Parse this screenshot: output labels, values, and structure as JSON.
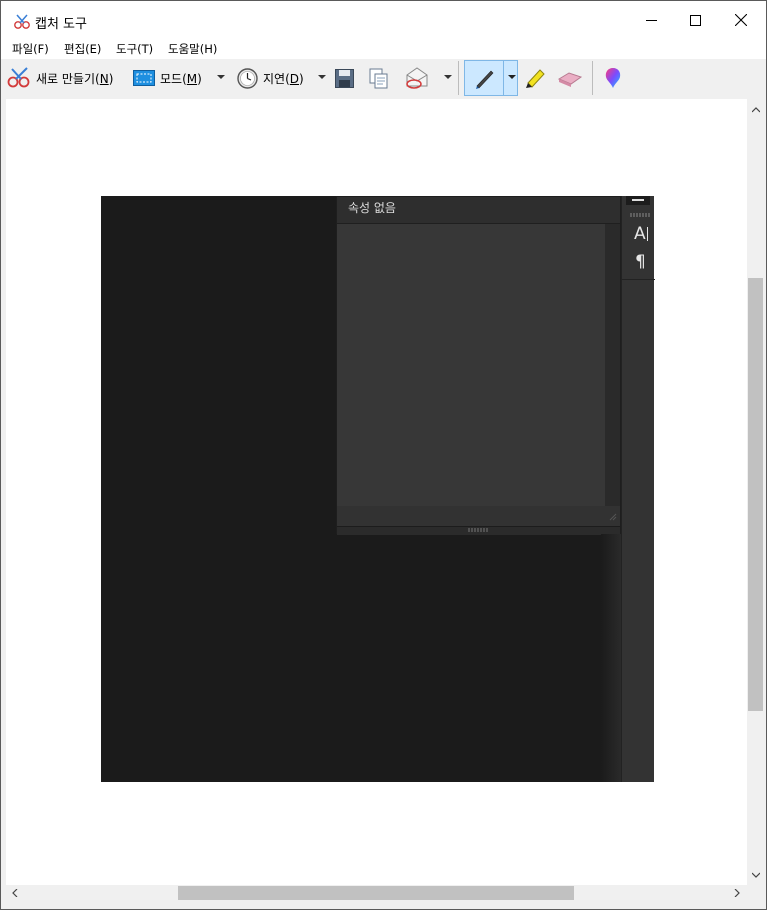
{
  "window": {
    "title": "캡처 도구"
  },
  "menu": {
    "file": "파일(F)",
    "edit": "편집(E)",
    "tools": "도구(T)",
    "help": "도움말(H)"
  },
  "toolbar": {
    "new_label": "새로 만들기(",
    "new_key": "N",
    "mode_label": "모드(",
    "mode_key": "M",
    "delay_label": "지연(",
    "delay_key": "D",
    "paren": ")"
  },
  "inner": {
    "panel_title": "속성 없음",
    "glyph_text": "A",
    "glyph_para": "¶"
  },
  "colors": {
    "accent_button": "#cce8ff",
    "capture_background": "#1b1b1b",
    "panel_background": "#323232"
  }
}
